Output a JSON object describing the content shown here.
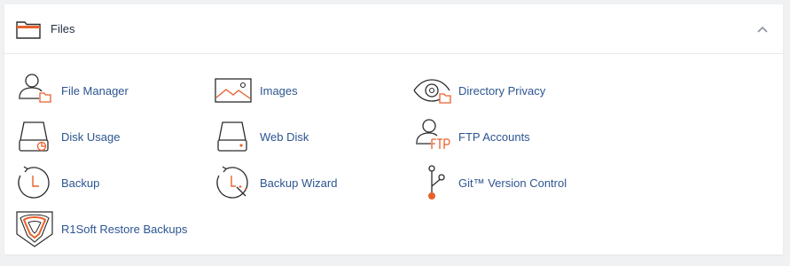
{
  "section": {
    "title": "Files",
    "folder_icon": "folder-icon",
    "collapse_icon": "chevron-up-icon"
  },
  "colors": {
    "accent": "#e8602c",
    "link": "#2c5591",
    "icon_stroke": "#2b2b2b"
  },
  "items": [
    {
      "label": "File Manager",
      "icon": "file-manager-icon"
    },
    {
      "label": "Images",
      "icon": "images-icon"
    },
    {
      "label": "Directory Privacy",
      "icon": "directory-privacy-icon"
    },
    {
      "label": "Disk Usage",
      "icon": "disk-usage-icon"
    },
    {
      "label": "Web Disk",
      "icon": "web-disk-icon"
    },
    {
      "label": "FTP Accounts",
      "icon": "ftp-accounts-icon"
    },
    {
      "label": "Backup",
      "icon": "backup-icon"
    },
    {
      "label": "Backup Wizard",
      "icon": "backup-wizard-icon"
    },
    {
      "label": "Git™ Version Control",
      "icon": "git-version-control-icon"
    },
    {
      "label": "R1Soft Restore Backups",
      "icon": "r1soft-restore-icon"
    }
  ]
}
